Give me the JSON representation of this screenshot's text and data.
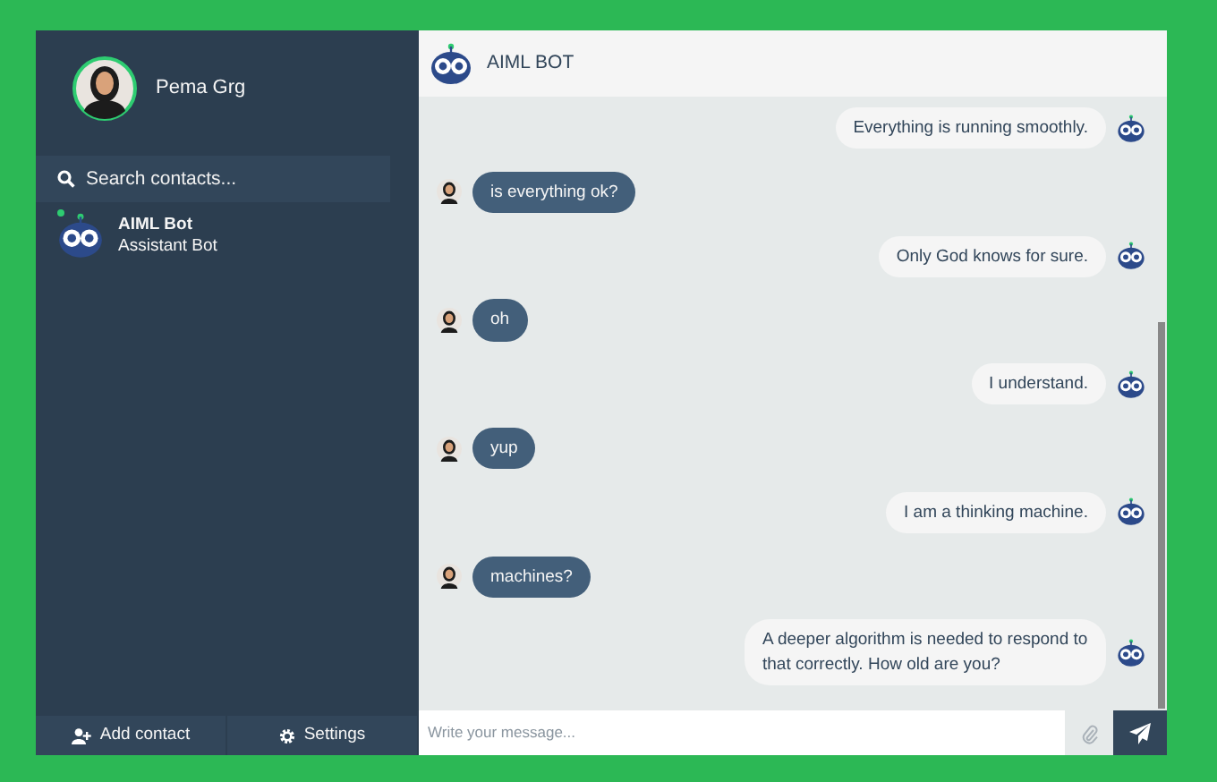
{
  "profile": {
    "name": "Pema Grg",
    "online": true
  },
  "search": {
    "placeholder": "Search contacts..."
  },
  "contacts": [
    {
      "name": "AIML Bot",
      "preview": "Assistant Bot",
      "online": true,
      "selected": false
    }
  ],
  "footer_buttons": [
    {
      "kind": "add",
      "label": "Add contact"
    },
    {
      "kind": "settings",
      "label": "Settings"
    }
  ],
  "chat_header": {
    "title": "AIML BOT"
  },
  "messages": [
    {
      "kind": "replies",
      "text": "Everything is running smoothly."
    },
    {
      "kind": "sent",
      "text": "is everything ok?"
    },
    {
      "kind": "replies",
      "text": "Only God knows for sure."
    },
    {
      "kind": "sent",
      "text": "oh"
    },
    {
      "kind": "replies",
      "text": "I understand."
    },
    {
      "kind": "sent",
      "text": "yup"
    },
    {
      "kind": "replies",
      "text": "I am a thinking machine."
    },
    {
      "kind": "sent",
      "text": "machines?"
    },
    {
      "kind": "replies",
      "text": "A deeper algorithm is needed to respond to that correctly. How old are you?"
    }
  ],
  "composer": {
    "placeholder": "Write your message..."
  }
}
